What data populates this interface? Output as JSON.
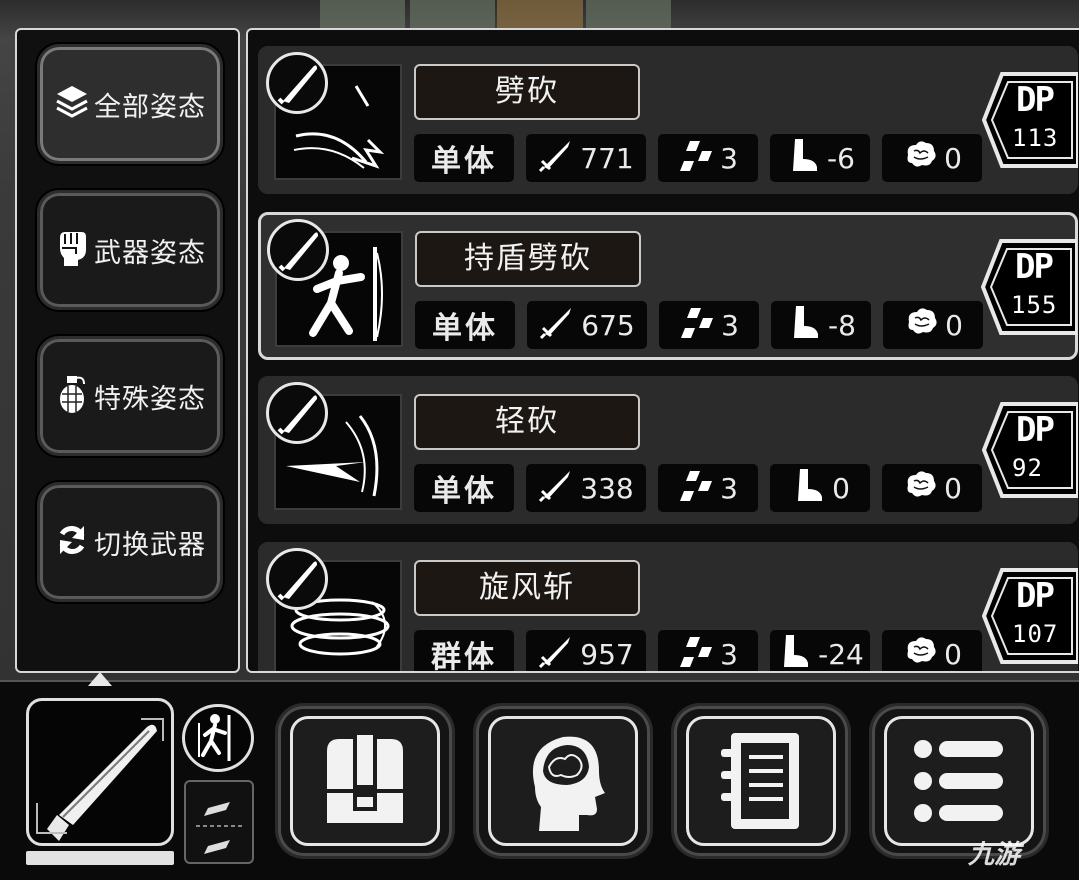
{
  "stances": [
    {
      "id": "all",
      "label": "全部姿态",
      "icon": "layers-icon",
      "active": true
    },
    {
      "id": "weapon",
      "label": "武器姿态",
      "icon": "fist-icon",
      "active": false
    },
    {
      "id": "special",
      "label": "特殊姿态",
      "icon": "grenade-icon",
      "active": false
    },
    {
      "id": "switch",
      "label": "切换武器",
      "icon": "swap-arrows-icon",
      "active": false
    }
  ],
  "skills": [
    {
      "name": "劈砍",
      "target": "单体",
      "damage": "771",
      "hits": "3",
      "move": "-6",
      "mind": "0",
      "dp_label": "DP",
      "dp": "113",
      "selected": false
    },
    {
      "name": "持盾劈砍",
      "target": "单体",
      "damage": "675",
      "hits": "3",
      "move": "-8",
      "mind": "0",
      "dp_label": "DP",
      "dp": "155",
      "selected": true
    },
    {
      "name": "轻砍",
      "target": "单体",
      "damage": "338",
      "hits": "3",
      "move": "0",
      "mind": "0",
      "dp_label": "DP",
      "dp": "92",
      "selected": false
    },
    {
      "name": "旋风斩",
      "target": "群体",
      "damage": "957",
      "hits": "3",
      "move": "-24",
      "mind": "0",
      "dp_label": "DP",
      "dp": "107",
      "selected": false
    }
  ],
  "bottom_menu": [
    {
      "id": "inventory",
      "icon": "backpack-icon"
    },
    {
      "id": "mind",
      "icon": "brain-head-icon"
    },
    {
      "id": "journal",
      "icon": "notebook-icon"
    },
    {
      "id": "menu",
      "icon": "list-icon"
    }
  ],
  "equipped": {
    "weapon_icon": "machete-icon",
    "durability": 1.0
  },
  "watermark": "九游",
  "colors": {
    "panel_border": "#d8d8d8",
    "card_bg": "#2b2b2b",
    "chip_bg": "#070707"
  }
}
